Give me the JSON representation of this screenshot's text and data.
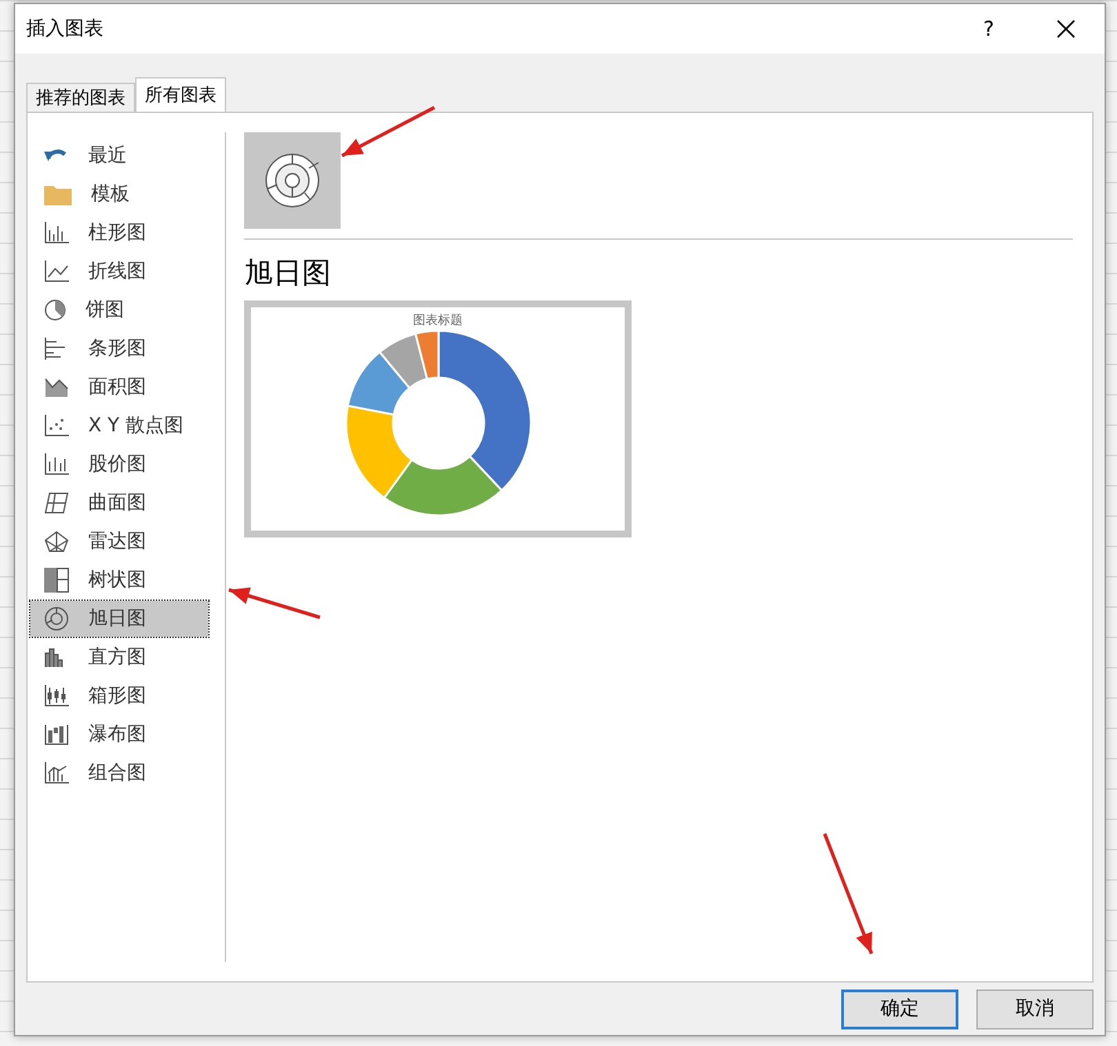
{
  "window": {
    "title": "插入图表",
    "help": "?"
  },
  "tabs": [
    {
      "label": "推荐的图表",
      "selected": false
    },
    {
      "label": "所有图表",
      "selected": true
    }
  ],
  "sidebar": {
    "items": [
      {
        "label": "最近",
        "selected": false
      },
      {
        "label": "模板",
        "selected": false
      },
      {
        "label": "柱形图",
        "selected": false
      },
      {
        "label": "折线图",
        "selected": false
      },
      {
        "label": "饼图",
        "selected": false
      },
      {
        "label": "条形图",
        "selected": false
      },
      {
        "label": "面积图",
        "selected": false
      },
      {
        "label": "X Y 散点图",
        "selected": false
      },
      {
        "label": "股价图",
        "selected": false
      },
      {
        "label": "曲面图",
        "selected": false
      },
      {
        "label": "雷达图",
        "selected": false
      },
      {
        "label": "树状图",
        "selected": false
      },
      {
        "label": "旭日图",
        "selected": true
      },
      {
        "label": "直方图",
        "selected": false
      },
      {
        "label": "箱形图",
        "selected": false
      },
      {
        "label": "瀑布图",
        "selected": false
      },
      {
        "label": "组合图",
        "selected": false
      }
    ]
  },
  "subtypes": [
    {
      "selected": true
    }
  ],
  "preview": {
    "heading": "旭日图",
    "chart_title": "图表标题"
  },
  "buttons": [
    {
      "label": "确定",
      "kind": "primary"
    },
    {
      "label": "取消",
      "kind": "secondary"
    }
  ]
}
